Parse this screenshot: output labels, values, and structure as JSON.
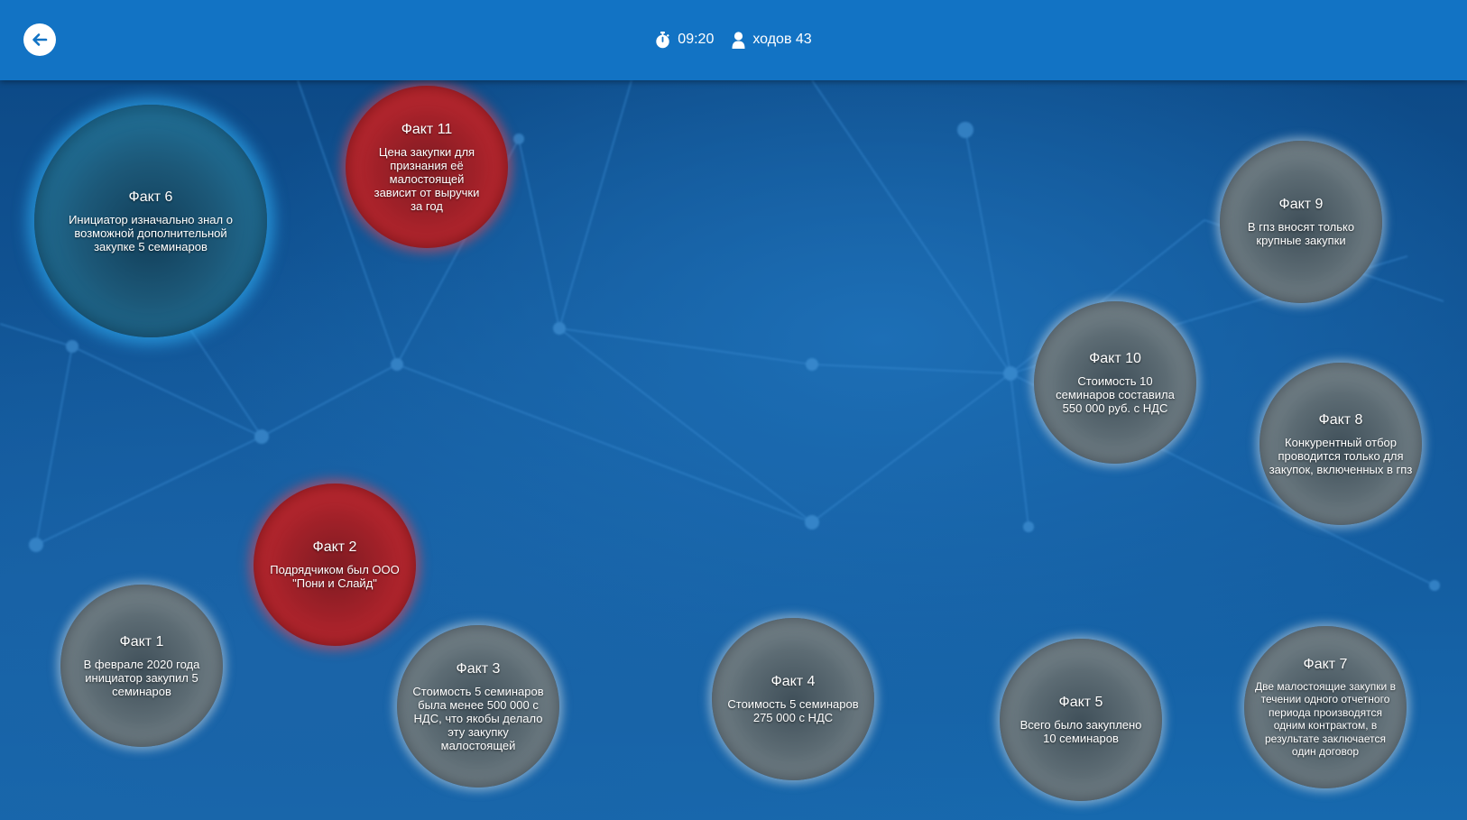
{
  "header": {
    "timer": "09:20",
    "moves": "ходов 43"
  },
  "facts": [
    {
      "title": "Факт 6",
      "text": "Инициатор изначально знал о возможной дополнительной закупке 5 семинаров",
      "state": "selected-blue"
    },
    {
      "title": "Факт 11",
      "text": "Цена закупки для признания её малостоящей зависит от выручки за год",
      "state": "red"
    },
    {
      "title": "Факт 9",
      "text": "В гпз вносят только крупные закупки",
      "state": "neutral"
    },
    {
      "title": "Факт 10",
      "text": "Стоимость 10 семинаров составила 550 000 руб. с НДС",
      "state": "neutral"
    },
    {
      "title": "Факт 8",
      "text": "Конкурентный отбор проводится только для закупок, включенных в гпз",
      "state": "neutral"
    },
    {
      "title": "Факт 2",
      "text": "Подрядчиком был ООО \"Пони и Слайд\"",
      "state": "red"
    },
    {
      "title": "Факт 1",
      "text": "В феврале 2020 года инициатор закупил 5 семинаров",
      "state": "neutral"
    },
    {
      "title": "Факт 3",
      "text": "Стоимость 5 семинаров была менее 500 000 с НДС, что якобы делало эту закупку малостоящей",
      "state": "neutral"
    },
    {
      "title": "Факт 4",
      "text": "Стоимость 5 семинаров 275 000 с НДС",
      "state": "neutral"
    },
    {
      "title": "Факт 5",
      "text": "Всего было закуплено 10 семинаров",
      "state": "neutral"
    },
    {
      "title": "Факт 7",
      "text": "Две малостоящие закупки в течении одного отчетного периода производятся одним контрактом, в результате заключается один договор",
      "state": "neutral"
    }
  ],
  "colors": {
    "header": "#1273c4",
    "background": "#0e4f8d",
    "fact_neutral": "#5d6c74",
    "fact_red": "#c42b33",
    "fact_selected": "#2590c4"
  },
  "icons": [
    "back-arrow-icon",
    "stopwatch-icon",
    "user-icon"
  ]
}
